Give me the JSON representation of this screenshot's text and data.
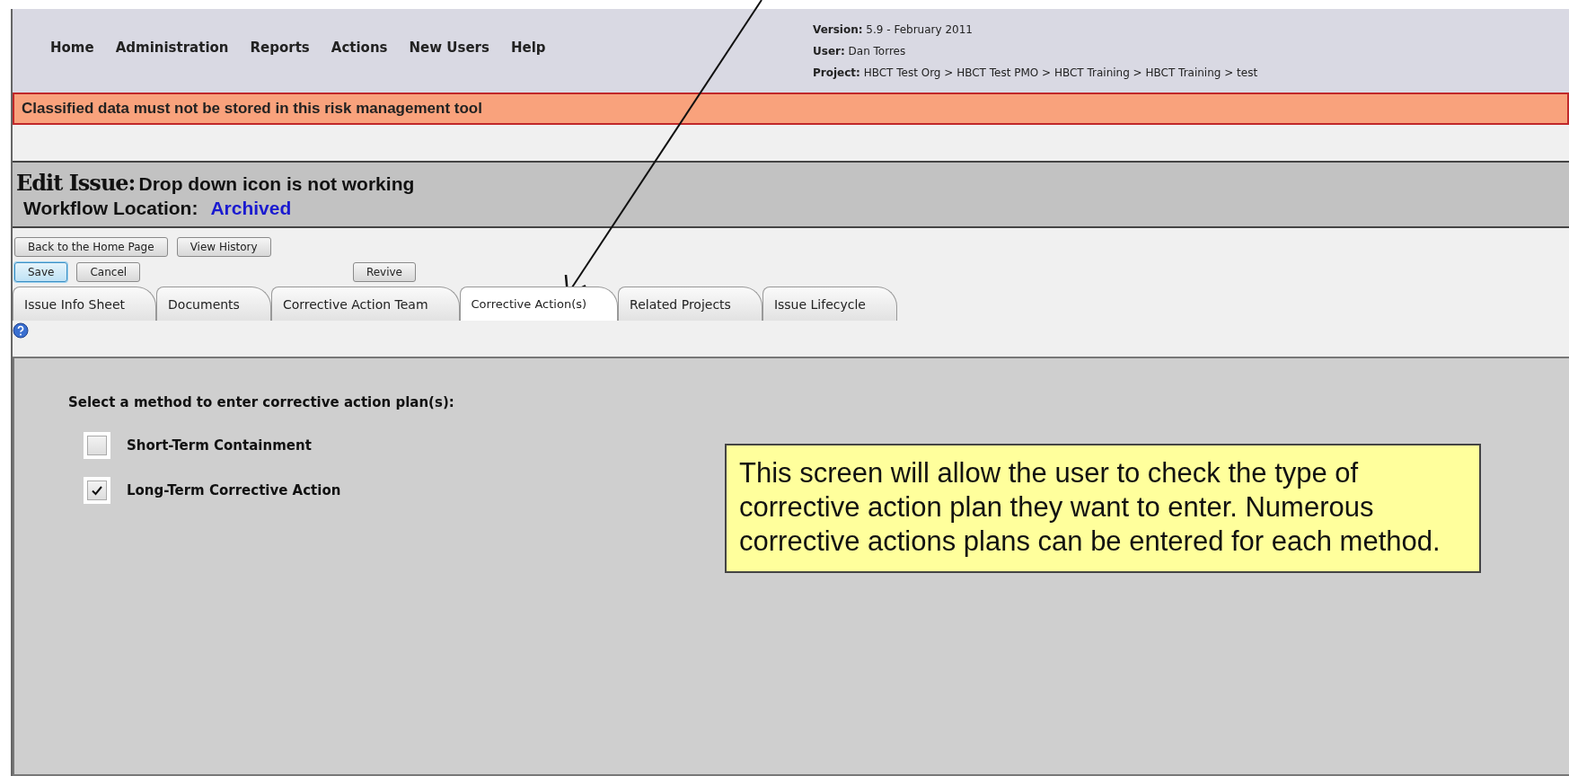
{
  "nav": [
    "Home",
    "Administration",
    "Reports",
    "Actions",
    "New Users",
    "Help"
  ],
  "header_info": [
    "**Version:** 5.9 - February 2011",
    "**User:** Dan Torres",
    "**Project:** HBCT Test Org > HBCT Test PMO > HBCT Training > HBCT Training > test"
  ],
  "banner": "Classified data must not be stored in this risk management tool",
  "issue": {
    "label": "Edit Issue:",
    "title": "Drop down icon is not working",
    "workflow_label": "Workflow Location:",
    "workflow_value": "Archived"
  },
  "button_rows": [
    {
      "left": [
        {
          "label": "Back to the Home Page",
          "focused": false
        },
        {
          "label": "View History",
          "focused": false
        }
      ],
      "right": []
    },
    {
      "left": [
        {
          "label": "Save",
          "focused": true
        },
        {
          "label": "Cancel",
          "focused": false
        }
      ],
      "right": [
        {
          "label": "Revive",
          "focused": false
        }
      ]
    }
  ],
  "tabs": [
    {
      "label": "Issue Info Sheet",
      "selected": false
    },
    {
      "label": "Documents",
      "selected": false
    },
    {
      "label": "Corrective Action Team",
      "selected": false
    },
    {
      "label": "Corrective Action(s)",
      "selected": true
    },
    {
      "label": "Related Projects",
      "selected": false
    },
    {
      "label": "Issue Lifecycle",
      "selected": false
    }
  ],
  "prompt": "Select a method to enter corrective action plan(s):",
  "methods": [
    {
      "label": "Short-Term Containment",
      "checked": false
    },
    {
      "label": "Long-Term Corrective Action",
      "checked": true
    }
  ],
  "callout": "This screen will allow the user to check the type of corrective action plan they want to enter. Numerous corrective actions plans can be entered for each method."
}
